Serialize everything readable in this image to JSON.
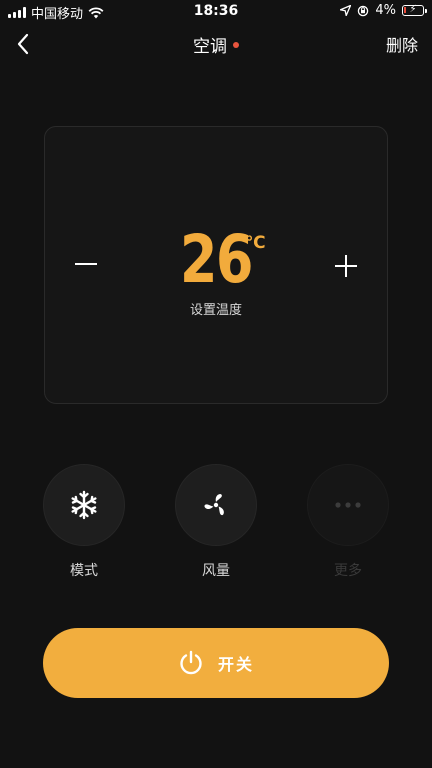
{
  "status_bar": {
    "carrier": "中国移动",
    "time": "18:36",
    "battery_percent": "4%"
  },
  "nav": {
    "title": "空调",
    "delete_label": "删除"
  },
  "temperature": {
    "value": "26",
    "unit": "℃",
    "label": "设置温度"
  },
  "functions": [
    {
      "label": "模式",
      "icon": "snowflake-icon"
    },
    {
      "label": "风量",
      "icon": "fan-icon"
    },
    {
      "label": "更多",
      "icon": "more-icon"
    }
  ],
  "power": {
    "label": "开关",
    "icon": "power-icon"
  },
  "colors": {
    "background": "#121212",
    "accent": "#f2ab3c",
    "power_button": "#f2ae3e",
    "status_dot": "#e8553e",
    "battery_low": "#e74c3c"
  }
}
